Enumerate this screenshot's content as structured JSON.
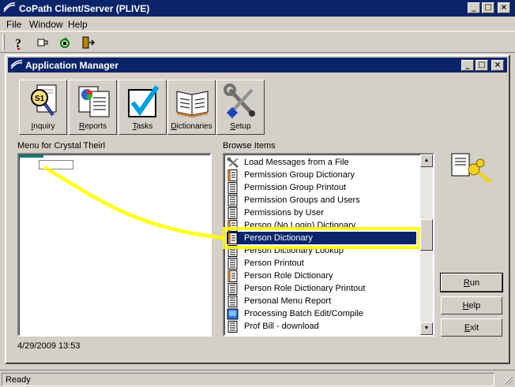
{
  "app": {
    "title": "CoPath Client/Server (PLIVE)",
    "menus": [
      "File",
      "Window",
      "Help"
    ]
  },
  "child": {
    "title": "Application Manager"
  },
  "modules": [
    {
      "label": "Inquiry",
      "icon": "inquiry-icon"
    },
    {
      "label": "Reports",
      "icon": "reports-icon"
    },
    {
      "label": "Tasks",
      "icon": "tasks-icon"
    },
    {
      "label": "Dictionaries",
      "icon": "dictionaries-icon"
    },
    {
      "label": "Setup",
      "icon": "setup-icon"
    }
  ],
  "menu_panel": {
    "label": "Menu for Crystal Theirl",
    "timestamp": "4/29/2009 13:53"
  },
  "browse": {
    "label": "Browse Items",
    "items": [
      {
        "text": "Load Messages from a File",
        "icon": "tools-icon"
      },
      {
        "text": "Permission Group Dictionary",
        "icon": "dictionary-doc-icon"
      },
      {
        "text": "Permission Group Printout",
        "icon": "printout-doc-icon"
      },
      {
        "text": "Permission Groups and Users",
        "icon": "printout-doc-icon"
      },
      {
        "text": "Permissions by User",
        "icon": "printout-doc-icon"
      },
      {
        "text": "Person (No Login) Dictionary",
        "icon": "dictionary-doc-icon"
      },
      {
        "text": "Person Dictionary",
        "icon": "dictionary-doc-icon",
        "selected": true
      },
      {
        "text": "Person Dictionary Lookup",
        "icon": "printout-doc-icon"
      },
      {
        "text": "Person Printout",
        "icon": "printout-doc-icon"
      },
      {
        "text": "Person Role Dictionary",
        "icon": "dictionary-doc-icon"
      },
      {
        "text": "Person Role Dictionary Printout",
        "icon": "printout-doc-icon"
      },
      {
        "text": "Personal Menu Report",
        "icon": "printout-doc-icon"
      },
      {
        "text": "Processing Batch Edit/Compile",
        "icon": "batch-icon"
      },
      {
        "text": "Prof Bill - download",
        "icon": "printout-doc-icon"
      }
    ]
  },
  "buttons": {
    "run": "Run",
    "help": "Help",
    "exit": "Exit"
  },
  "status": {
    "text": "Ready"
  },
  "colors": {
    "title_bar": "#0a246a",
    "face": "#d4d0c8",
    "annotation": "#ffff00"
  }
}
